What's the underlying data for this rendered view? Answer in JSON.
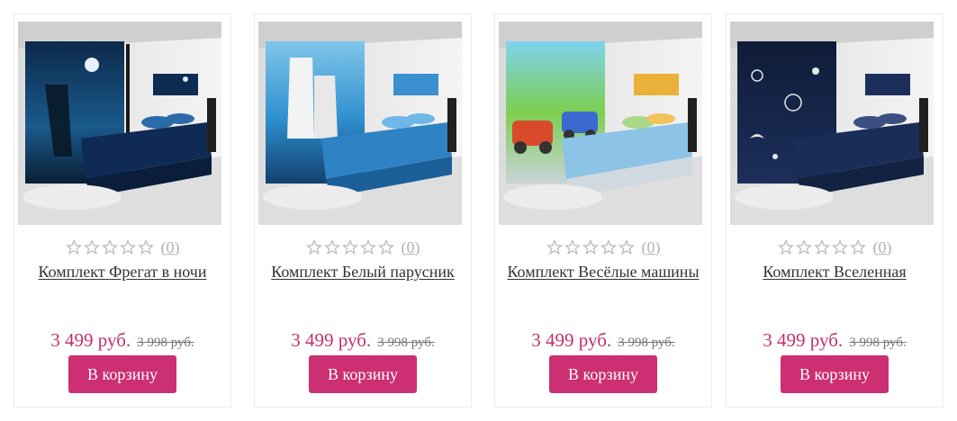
{
  "colors": {
    "accent": "#cc2f72",
    "price": "#c2306f",
    "star": "#b8b8b8"
  },
  "products": [
    {
      "image_desc": "bedroom with dark blue frigate-at-night curtains and bedding",
      "rating_count": "(0)",
      "title": "Комплект Фрегат в ночи",
      "price_new": "3 499 руб.",
      "price_old": "3 998 руб.",
      "button": "В корзину"
    },
    {
      "image_desc": "bedroom with white sailing ship curtains and bedding",
      "rating_count": "(0)",
      "title": "Комплект Белый парусник",
      "price_new": "3 499 руб.",
      "price_old": "3 998 руб.",
      "button": "В корзину"
    },
    {
      "image_desc": "bedroom with colorful cartoon cars curtains and bedding",
      "rating_count": "(0)",
      "title": "Комплект Весёлые машины",
      "price_new": "3 499 руб.",
      "price_old": "3 998 руб.",
      "button": "В корзину"
    },
    {
      "image_desc": "bedroom with dark navy outer-space curtains and bedding",
      "rating_count": "(0)",
      "title": "Комплект Вселенная",
      "price_new": "3 499 руб.",
      "price_old": "3 998 руб.",
      "button": "В корзину"
    }
  ]
}
